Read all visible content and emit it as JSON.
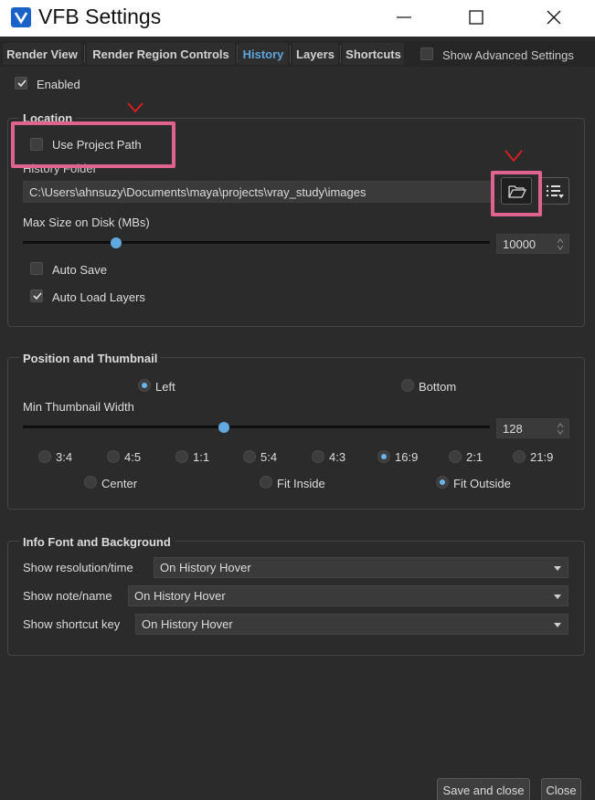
{
  "window": {
    "title": "VFB Settings",
    "minimize_icon": "minimize-icon",
    "maximize_icon": "maximize-icon",
    "close_icon": "close-icon"
  },
  "tabs": [
    {
      "label": "Render View"
    },
    {
      "label": "Render Region Controls"
    },
    {
      "label": "History",
      "active": true
    },
    {
      "label": "Layers"
    },
    {
      "label": "Shortcuts"
    }
  ],
  "show_advanced": {
    "label": "Show Advanced Settings",
    "checked": false
  },
  "enabled": {
    "label": "Enabled",
    "checked": true
  },
  "location": {
    "title": "Location",
    "use_project_path": {
      "label": "Use Project Path",
      "checked": false
    },
    "history_folder_label": "History Folder",
    "history_folder_value": "C:\\Users\\ahnsuzy\\Documents\\maya\\projects\\vray_study\\images",
    "browse_icon": "folder-open-icon",
    "menu_icon": "list-menu-icon",
    "max_size_label": "Max Size on Disk (MBs)",
    "max_size_value": "10000",
    "max_size_slider_fraction": 0.2,
    "auto_save": {
      "label": "Auto Save",
      "checked": false
    },
    "auto_load_layers": {
      "label": "Auto Load Layers",
      "checked": true
    }
  },
  "position": {
    "title": "Position and Thumbnail",
    "left": {
      "label": "Left",
      "selected": true
    },
    "bottom": {
      "label": "Bottom",
      "selected": false
    },
    "min_width_label": "Min Thumbnail Width",
    "min_width_value": "128",
    "min_width_slider_fraction": 0.43,
    "ratios": [
      {
        "label": "3:4",
        "selected": false
      },
      {
        "label": "4:5",
        "selected": false
      },
      {
        "label": "1:1",
        "selected": false
      },
      {
        "label": "5:4",
        "selected": false
      },
      {
        "label": "4:3",
        "selected": false
      },
      {
        "label": "16:9",
        "selected": true
      },
      {
        "label": "2:1",
        "selected": false
      },
      {
        "label": "21:9",
        "selected": false
      }
    ],
    "fit": [
      {
        "label": "Center",
        "selected": false
      },
      {
        "label": "Fit Inside",
        "selected": false
      },
      {
        "label": "Fit Outside",
        "selected": true
      }
    ]
  },
  "info": {
    "title": "Info Font and Background",
    "show_resolution": {
      "label": "Show resolution/time",
      "value": "On History Hover"
    },
    "show_note": {
      "label": "Show note/name",
      "value": "On History Hover"
    },
    "show_shortcut": {
      "label": "Show shortcut key",
      "value": "On History Hover"
    }
  },
  "footer": {
    "save_close_label": "Save and close",
    "close_label": "Close"
  },
  "colors": {
    "background": "#2b2b2b",
    "accent": "#5da6dd",
    "annotation_pink": "#e0628f",
    "annotation_red": "#e02020"
  }
}
